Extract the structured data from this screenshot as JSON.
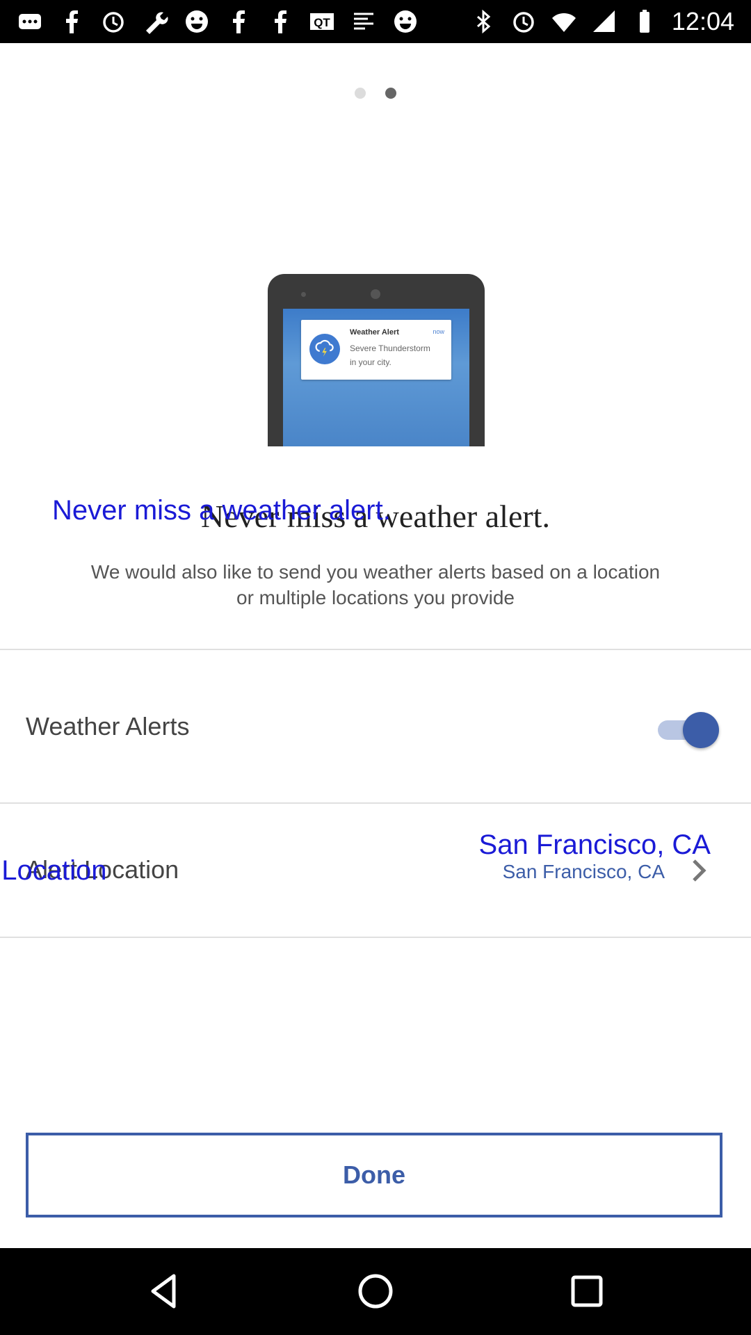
{
  "status_bar": {
    "time": "12:04",
    "left_icons": [
      "more-icon",
      "facebook-icon",
      "alarm-icon",
      "wrench-icon",
      "smiley-icon",
      "facebook-icon",
      "facebook-icon",
      "qt-icon",
      "news-icon",
      "smiley-icon"
    ],
    "right_icons": [
      "bluetooth-icon",
      "alarm-icon",
      "wifi-icon",
      "signal-icon",
      "battery-icon"
    ]
  },
  "pager": {
    "total": 2,
    "active_index": 1
  },
  "illustration": {
    "notification_title": "Weather Alert",
    "notification_time": "now",
    "notification_line1": "Severe Thunderstorm",
    "notification_line2": "in your city."
  },
  "heading": "Never miss a weather alert.",
  "heading_overlay": "Never miss a weather alert.",
  "subtitle": "We would also like to send you weather alerts based on a location or multiple locations you provide",
  "weather_alerts": {
    "label": "Weather Alerts",
    "enabled": true
  },
  "alert_location": {
    "label": "Alert Location",
    "overlay_label": "t Location",
    "value": "San Francisco, CA",
    "value_overlay": "San Francisco, CA"
  },
  "done_label": "Done",
  "colors": {
    "accent": "#3c5da8",
    "overlay_blue": "#1a1ad6"
  }
}
